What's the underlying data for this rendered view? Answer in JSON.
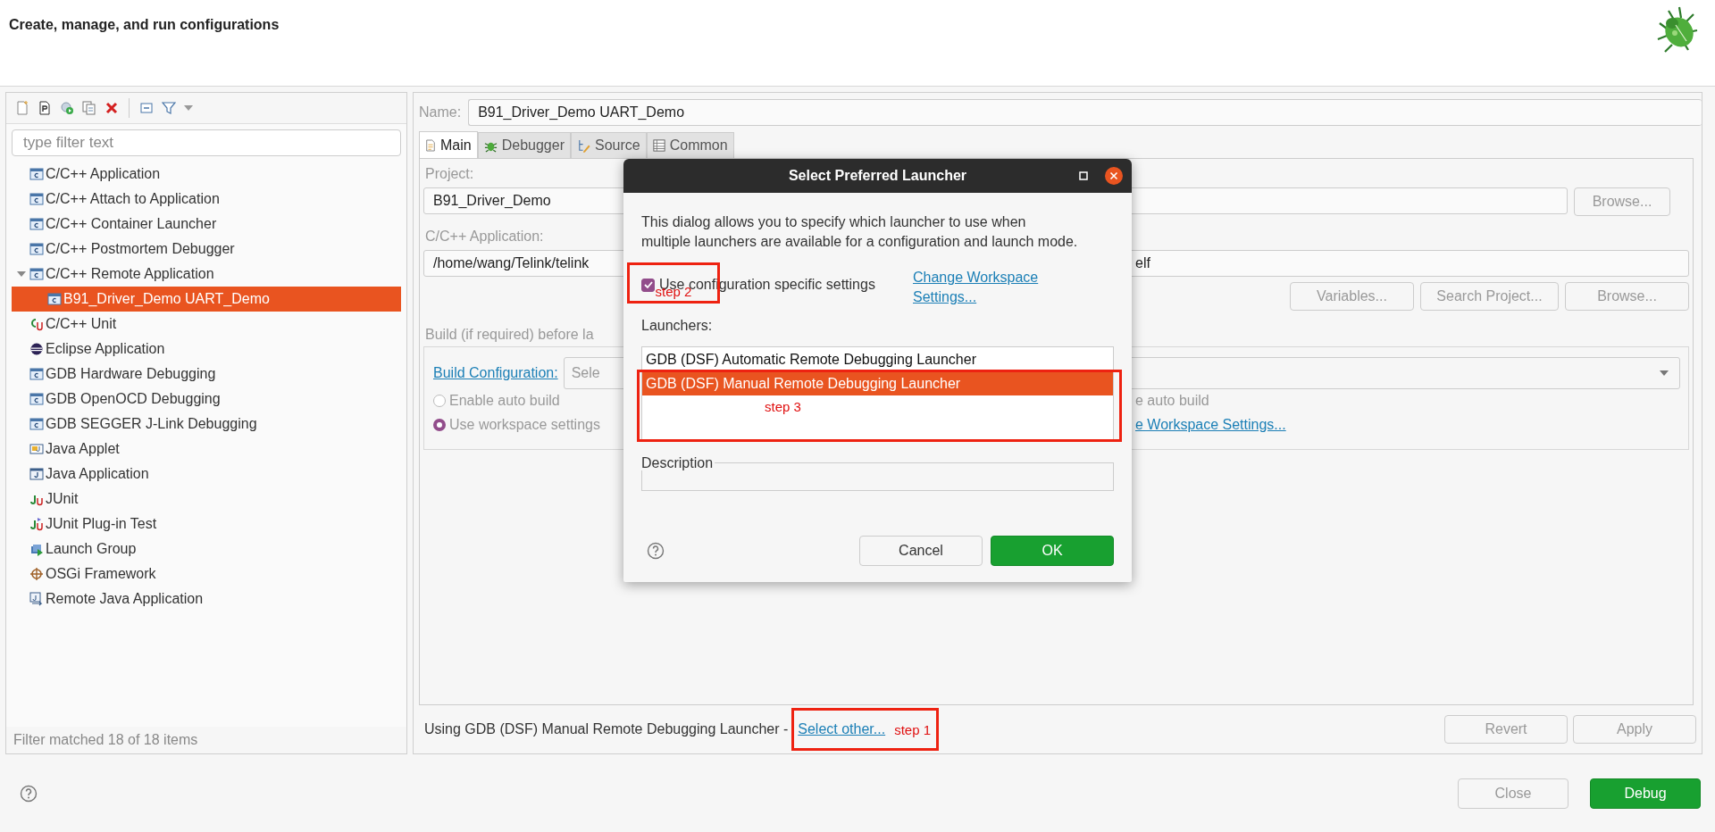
{
  "header": {
    "title": "Create, manage, and run configurations"
  },
  "filter": {
    "placeholder": "type filter text"
  },
  "tree": [
    {
      "label": "C/C++ Application",
      "kind": "c",
      "selected": false
    },
    {
      "label": "C/C++ Attach to Application",
      "kind": "c",
      "selected": false
    },
    {
      "label": "C/C++ Container Launcher",
      "kind": "c",
      "selected": false
    },
    {
      "label": "C/C++ Postmortem Debugger",
      "kind": "c",
      "selected": false
    },
    {
      "label": "C/C++ Remote Application",
      "kind": "c",
      "selected": false,
      "expanded": true,
      "children": [
        {
          "label": "B91_Driver_Demo UART_Demo",
          "kind": "c",
          "selected": true
        }
      ]
    },
    {
      "label": "C/C++ Unit",
      "kind": "cunit",
      "selected": false
    },
    {
      "label": "Eclipse Application",
      "kind": "eclipse",
      "selected": false
    },
    {
      "label": "GDB Hardware Debugging",
      "kind": "c",
      "selected": false
    },
    {
      "label": "GDB OpenOCD Debugging",
      "kind": "c",
      "selected": false
    },
    {
      "label": "GDB SEGGER J-Link Debugging",
      "kind": "c",
      "selected": false
    },
    {
      "label": "Java Applet",
      "kind": "applet",
      "selected": false
    },
    {
      "label": "Java Application",
      "kind": "java",
      "selected": false
    },
    {
      "label": "JUnit",
      "kind": "junit",
      "selected": false
    },
    {
      "label": "JUnit Plug-in Test",
      "kind": "junit-plugin",
      "selected": false
    },
    {
      "label": "Launch Group",
      "kind": "group",
      "selected": false
    },
    {
      "label": "OSGi Framework",
      "kind": "osgi",
      "selected": false
    },
    {
      "label": "Remote Java Application",
      "kind": "remote-java",
      "selected": false
    }
  ],
  "filter_status": "Filter matched 18 of 18 items",
  "config": {
    "name_label": "Name:",
    "name": "B91_Driver_Demo UART_Demo",
    "tabs": [
      {
        "label": "Main",
        "kind": "main",
        "selected": true
      },
      {
        "label": "Debugger",
        "kind": "debugger",
        "selected": false
      },
      {
        "label": "Source",
        "kind": "source",
        "selected": false
      },
      {
        "label": "Common",
        "kind": "common",
        "selected": false
      }
    ],
    "project_label": "Project:",
    "project": "B91_Driver_Demo",
    "project_button": "Browse...",
    "application_label": "C/C++ Application:",
    "application_start": "/home/wang/Telink/telink",
    "application_end": "elf",
    "application_buttons": [
      "Variables...",
      "Search Project...",
      "Browse..."
    ],
    "build_group": {
      "title": "Build (if required) before la",
      "config_link": "Build Configuration:",
      "config_select": "Sele",
      "options": [
        {
          "label": "Enable auto build",
          "selected": false,
          "disabled": true,
          "right_text": "e auto build"
        },
        {
          "label": "Use workspace settings",
          "selected": true,
          "disabled": true,
          "right_link": "e Workspace Settings..."
        }
      ]
    }
  },
  "launcher_bar": {
    "text": "Using GDB (DSF) Manual Remote Debugging Launcher -",
    "link": "Select other...",
    "annotation": "step 1",
    "buttons": [
      {
        "label": "Revert",
        "disabled": true
      },
      {
        "label": "Apply",
        "disabled": true
      }
    ]
  },
  "buttons": [
    {
      "label": "Close",
      "kind": "secondary",
      "disabled": true
    },
    {
      "label": "Debug",
      "kind": "primary",
      "disabled": false
    }
  ],
  "dialog": {
    "title": "Select Preferred Launcher",
    "message": "This dialog allows you to specify which launcher to use when multiple launchers are available for a configuration and launch mode.",
    "use_specific": {
      "label": "Use configuration specific settings",
      "checked": true,
      "annotation": "step 2"
    },
    "workspace_link": "Change Workspace Settings...",
    "launchers_label": "Launchers:",
    "launchers": [
      {
        "label": "GDB (DSF) Automatic Remote Debugging Launcher",
        "selected": false
      },
      {
        "label": "GDB (DSF) Manual Remote Debugging Launcher",
        "selected": true
      }
    ],
    "launchers_annotation": "step 3",
    "description_label": "Description",
    "buttons": [
      {
        "label": "Cancel",
        "kind": "secondary"
      },
      {
        "label": "OK",
        "kind": "primary"
      }
    ]
  }
}
